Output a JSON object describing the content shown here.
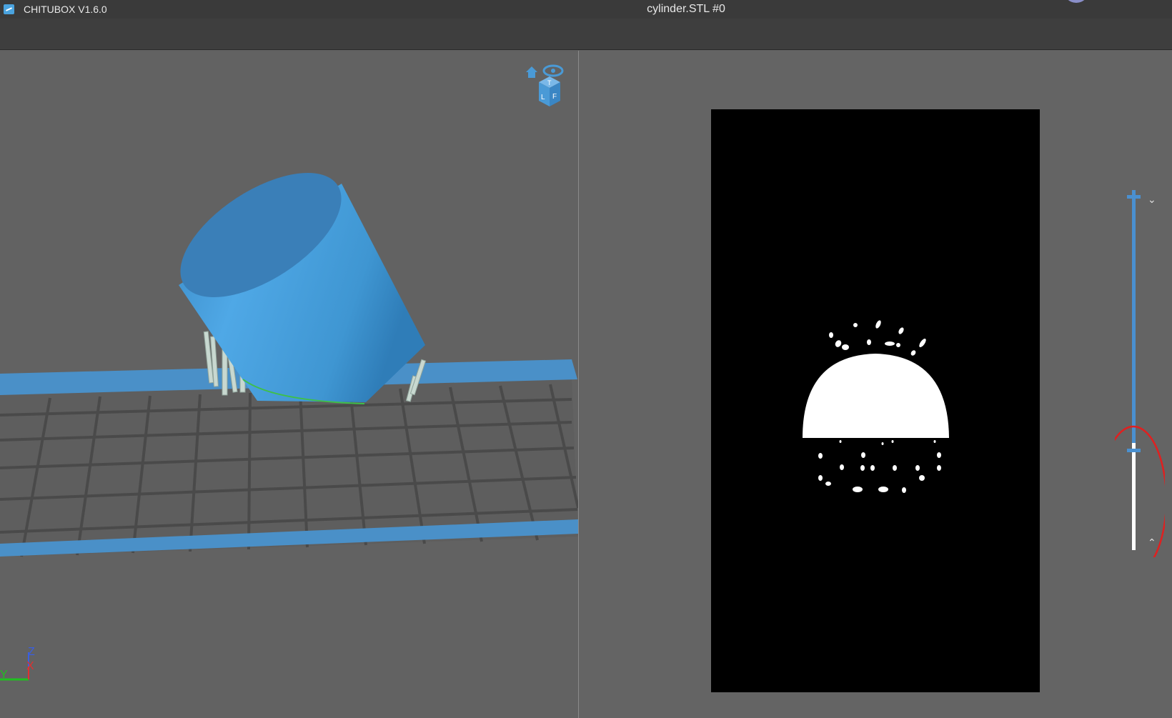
{
  "window": {
    "app_name": "CHITUBOX V1.6.0",
    "document_title": "cylinder.STL #0"
  },
  "viewport_3d": {
    "model": "cylinder",
    "view_cube_faces": [
      "T",
      "L",
      "F"
    ],
    "axes": [
      "Z",
      "X",
      "Y"
    ]
  },
  "colors": {
    "model": "#4aa3e0",
    "plate_border": "#4a90c8",
    "supports": "#c8d8d0",
    "slice_bg": "#000000",
    "slice_fill": "#ffffff",
    "slider_active": "#4a90d0",
    "highlight_circle": "#e02020"
  },
  "layer_slider": {
    "up_icon": "chevron-up-icon",
    "down_icon": "chevron-down-icon",
    "current_level_fraction": 0.28
  }
}
